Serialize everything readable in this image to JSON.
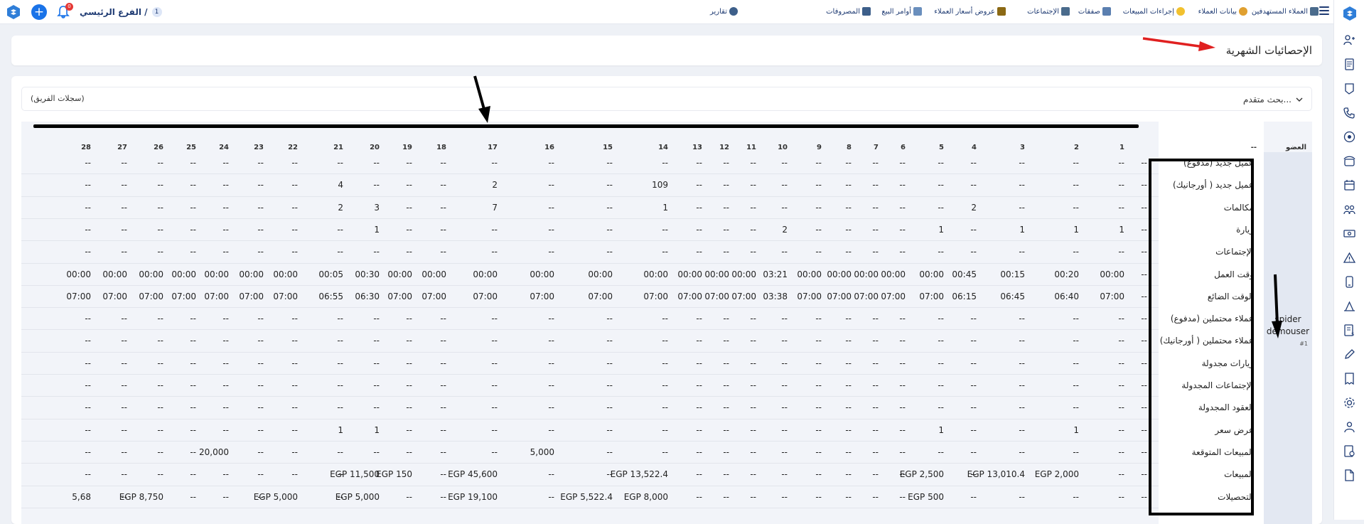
{
  "header": {
    "branch_label": "الفرع الرئيسي /",
    "branch_count": "1",
    "notification_badge": "0",
    "nav": [
      {
        "label": "العملاء المستهدفين",
        "icon": "target-users-icon",
        "color": "#4a6b8c"
      },
      {
        "label": "بيانات العملاء",
        "icon": "customer-data-icon",
        "color": "#e0a030"
      },
      {
        "label": "إجراءات المبيعات",
        "icon": "lightbulb-icon",
        "color": "#f2c12e"
      },
      {
        "label": "صفقات",
        "icon": "deals-icon",
        "color": "#5b7fb0"
      },
      {
        "label": "الإجتماعات",
        "icon": "meeting-icon",
        "color": "#4a6b8c"
      },
      {
        "label": "عروض أسعار العملاء",
        "icon": "quotes-icon",
        "color": "#8b6914"
      },
      {
        "label": "أوامر البيع",
        "icon": "sales-order-icon",
        "color": "#6a8fbd"
      },
      {
        "label": "المصروفات",
        "icon": "expenses-icon",
        "color": "#3d5f8a"
      },
      {
        "label": "تقارير",
        "icon": "reports-icon",
        "color": "#3d5f8a"
      }
    ]
  },
  "page": {
    "title": "الإحصائيات الشهرية"
  },
  "filters": {
    "advanced_search": "بحث متقدم...",
    "team_records": "(سجلات الفريق)"
  },
  "table": {
    "member_header": "العضو",
    "dash_header": "--",
    "day_headers": [
      "1",
      "2",
      "3",
      "4",
      "5",
      "6",
      "7",
      "8",
      "9",
      "10",
      "11",
      "12",
      "13",
      "14",
      "15",
      "16",
      "17",
      "18",
      "19",
      "20",
      "21",
      "22",
      "23",
      "24",
      "25",
      "26",
      "27",
      "28"
    ],
    "member": {
      "name_line1": "spider",
      "name_line2": "demouser",
      "id": "#1"
    },
    "rows": [
      {
        "label": "عميل جديد (مدفوع)",
        "values": [
          "--",
          "--",
          "--",
          "--",
          "--",
          "--",
          "--",
          "--",
          "--",
          "--",
          "--",
          "--",
          "--",
          "--",
          "--",
          "--",
          "--",
          "--",
          "--",
          "--",
          "--",
          "--",
          "--",
          "--",
          "--",
          "--",
          "--",
          "--"
        ]
      },
      {
        "label": "عميل جديد ( أورجانيك)",
        "values": [
          "--",
          "--",
          "--",
          "--",
          "--",
          "--",
          "--",
          "--",
          "--",
          "--",
          "--",
          "--",
          "--",
          "109",
          "--",
          "--",
          "2",
          "--",
          "--",
          "--",
          "4",
          "--",
          "--",
          "--",
          "--",
          "--",
          "--",
          "--"
        ]
      },
      {
        "label": "مكالمات",
        "values": [
          "--",
          "--",
          "--",
          "2",
          "--",
          "--",
          "--",
          "--",
          "--",
          "--",
          "--",
          "--",
          "--",
          "1",
          "--",
          "--",
          "7",
          "--",
          "--",
          "3",
          "2",
          "--",
          "--",
          "--",
          "--",
          "--",
          "--",
          "--"
        ]
      },
      {
        "label": "زيارة",
        "values": [
          "1",
          "1",
          "1",
          "--",
          "1",
          "--",
          "--",
          "--",
          "--",
          "2",
          "--",
          "--",
          "--",
          "--",
          "--",
          "--",
          "--",
          "--",
          "--",
          "1",
          "--",
          "--",
          "--",
          "--",
          "--",
          "--",
          "--",
          "--"
        ]
      },
      {
        "label": "الإجتماعات",
        "values": [
          "--",
          "--",
          "--",
          "--",
          "--",
          "--",
          "--",
          "--",
          "--",
          "--",
          "--",
          "--",
          "--",
          "--",
          "--",
          "--",
          "--",
          "--",
          "--",
          "--",
          "--",
          "--",
          "--",
          "--",
          "--",
          "--",
          "--",
          "--"
        ]
      },
      {
        "label": "وقت العمل",
        "values": [
          "00:00",
          "00:20",
          "00:15",
          "00:45",
          "00:00",
          "00:00",
          "00:00",
          "00:00",
          "00:00",
          "03:21",
          "00:00",
          "00:00",
          "00:00",
          "00:00",
          "00:00",
          "00:00",
          "00:00",
          "00:00",
          "00:00",
          "00:30",
          "00:05",
          "00:00",
          "00:00",
          "00:00",
          "00:00",
          "00:00",
          "00:00",
          "00:00"
        ]
      },
      {
        "label": "الوقت الضائع",
        "values": [
          "07:00",
          "06:40",
          "06:45",
          "06:15",
          "07:00",
          "07:00",
          "07:00",
          "07:00",
          "07:00",
          "03:38",
          "07:00",
          "07:00",
          "07:00",
          "07:00",
          "07:00",
          "07:00",
          "07:00",
          "07:00",
          "07:00",
          "06:30",
          "06:55",
          "07:00",
          "07:00",
          "07:00",
          "07:00",
          "07:00",
          "07:00",
          "07:00"
        ]
      },
      {
        "label": "عملاء محتملين (مدفوع)",
        "values": [
          "--",
          "--",
          "--",
          "--",
          "--",
          "--",
          "--",
          "--",
          "--",
          "--",
          "--",
          "--",
          "--",
          "--",
          "--",
          "--",
          "--",
          "--",
          "--",
          "--",
          "--",
          "--",
          "--",
          "--",
          "--",
          "--",
          "--",
          "--"
        ]
      },
      {
        "label": "عملاء محتملين ( أورجانيك)",
        "values": [
          "--",
          "--",
          "--",
          "--",
          "--",
          "--",
          "--",
          "--",
          "--",
          "--",
          "--",
          "--",
          "--",
          "--",
          "--",
          "--",
          "--",
          "--",
          "--",
          "--",
          "--",
          "--",
          "--",
          "--",
          "--",
          "--",
          "--",
          "--"
        ]
      },
      {
        "label": "زيارات مجدولة",
        "values": [
          "--",
          "--",
          "--",
          "--",
          "--",
          "--",
          "--",
          "--",
          "--",
          "--",
          "--",
          "--",
          "--",
          "--",
          "--",
          "--",
          "--",
          "--",
          "--",
          "--",
          "--",
          "--",
          "--",
          "--",
          "--",
          "--",
          "--",
          "--"
        ]
      },
      {
        "label": "الإجتماعات المجدولة",
        "values": [
          "--",
          "--",
          "--",
          "--",
          "--",
          "--",
          "--",
          "--",
          "--",
          "--",
          "--",
          "--",
          "--",
          "--",
          "--",
          "--",
          "--",
          "--",
          "--",
          "--",
          "--",
          "--",
          "--",
          "--",
          "--",
          "--",
          "--",
          "--"
        ]
      },
      {
        "label": "العقود المجدولة",
        "values": [
          "--",
          "--",
          "--",
          "--",
          "--",
          "--",
          "--",
          "--",
          "--",
          "--",
          "--",
          "--",
          "--",
          "--",
          "--",
          "--",
          "--",
          "--",
          "--",
          "--",
          "--",
          "--",
          "--",
          "--",
          "--",
          "--",
          "--",
          "--"
        ]
      },
      {
        "label": "عرض سعر",
        "values": [
          "--",
          "1",
          "--",
          "--",
          "1",
          "--",
          "--",
          "--",
          "--",
          "--",
          "--",
          "--",
          "--",
          "--",
          "--",
          "--",
          "--",
          "--",
          "--",
          "1",
          "1",
          "--",
          "--",
          "--",
          "--",
          "--",
          "--",
          "--"
        ]
      },
      {
        "label": "المبيعات المتوقعة",
        "values": [
          "--",
          "--",
          "--",
          "--",
          "--",
          "--",
          "--",
          "--",
          "--",
          "--",
          "--",
          "--",
          "--",
          "--",
          "--",
          "5,000",
          "--",
          "--",
          "--",
          "--",
          "--",
          "--",
          "--",
          "20,000",
          "--",
          "--",
          "--",
          "--"
        ]
      },
      {
        "label": "المبيعات",
        "values": [
          "--",
          "EGP 2,000",
          "EGP 13,010.4",
          "--",
          "EGP 2,500",
          "--",
          "--",
          "--",
          "--",
          "--",
          "--",
          "--",
          "--",
          "EGP 13,522.4",
          "--",
          "--",
          "EGP 45,600",
          "--",
          "EGP 150",
          "EGP 11,500",
          "--",
          "--",
          "--",
          "--",
          "--",
          "--",
          "--",
          "--"
        ]
      },
      {
        "label": "التحصيلات",
        "values": [
          "--",
          "--",
          "--",
          "--",
          "EGP 500",
          "--",
          "--",
          "--",
          "--",
          "--",
          "--",
          "--",
          "--",
          "EGP 8,000",
          "EGP 5,522.4",
          "--",
          "EGP 19,100",
          "--",
          "--",
          "EGP 5,000",
          "--",
          "EGP 5,000",
          "--",
          "--",
          "--",
          "EGP 8,750",
          "--",
          "5,68"
        ]
      }
    ]
  },
  "sidebar": {
    "icons": [
      "contacts-icon",
      "document-icon",
      "shield-icon",
      "phone-icon",
      "compass-icon",
      "telephone-icon",
      "calendar-icon",
      "team-icon",
      "money-icon",
      "warning-icon",
      "device-icon",
      "sales-icon",
      "invoice-icon",
      "pen-icon",
      "receipt-icon",
      "settings-icon",
      "user-icon",
      "payment-icon",
      "file-icon"
    ]
  }
}
